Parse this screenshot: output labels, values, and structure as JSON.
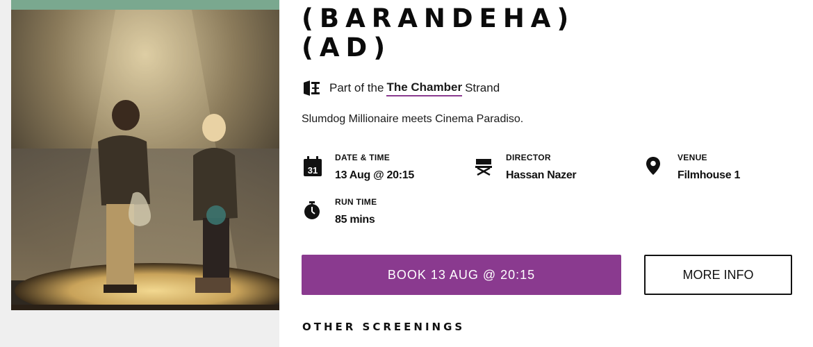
{
  "film": {
    "title_line1": "(BARANDEHA)",
    "title_line2": "(AD)",
    "tagline": "Slumdog Millionaire meets Cinema Paradiso."
  },
  "strand": {
    "prefix": "Part of the",
    "name": "The Chamber",
    "suffix": "Strand",
    "icon": "film-chamber-icon"
  },
  "details": {
    "date_time": {
      "label": "DATE & TIME",
      "value": "13 Aug @ 20:15",
      "icon": "calendar-icon",
      "icon_text": "31"
    },
    "director": {
      "label": "DIRECTOR",
      "value": "Hassan Nazer",
      "icon": "director-chair-icon"
    },
    "venue": {
      "label": "VENUE",
      "value": "Filmhouse 1",
      "icon": "map-pin-icon"
    },
    "run_time": {
      "label": "RUN TIME",
      "value": "85 mins",
      "icon": "stopwatch-icon"
    }
  },
  "actions": {
    "book_label": "BOOK 13 AUG @ 20:15",
    "more_info_label": "MORE INFO"
  },
  "other_screenings": {
    "heading": "OTHER SCREENINGS"
  },
  "colors": {
    "accent": "#8a3a8f",
    "strip": "#7aa88f"
  }
}
